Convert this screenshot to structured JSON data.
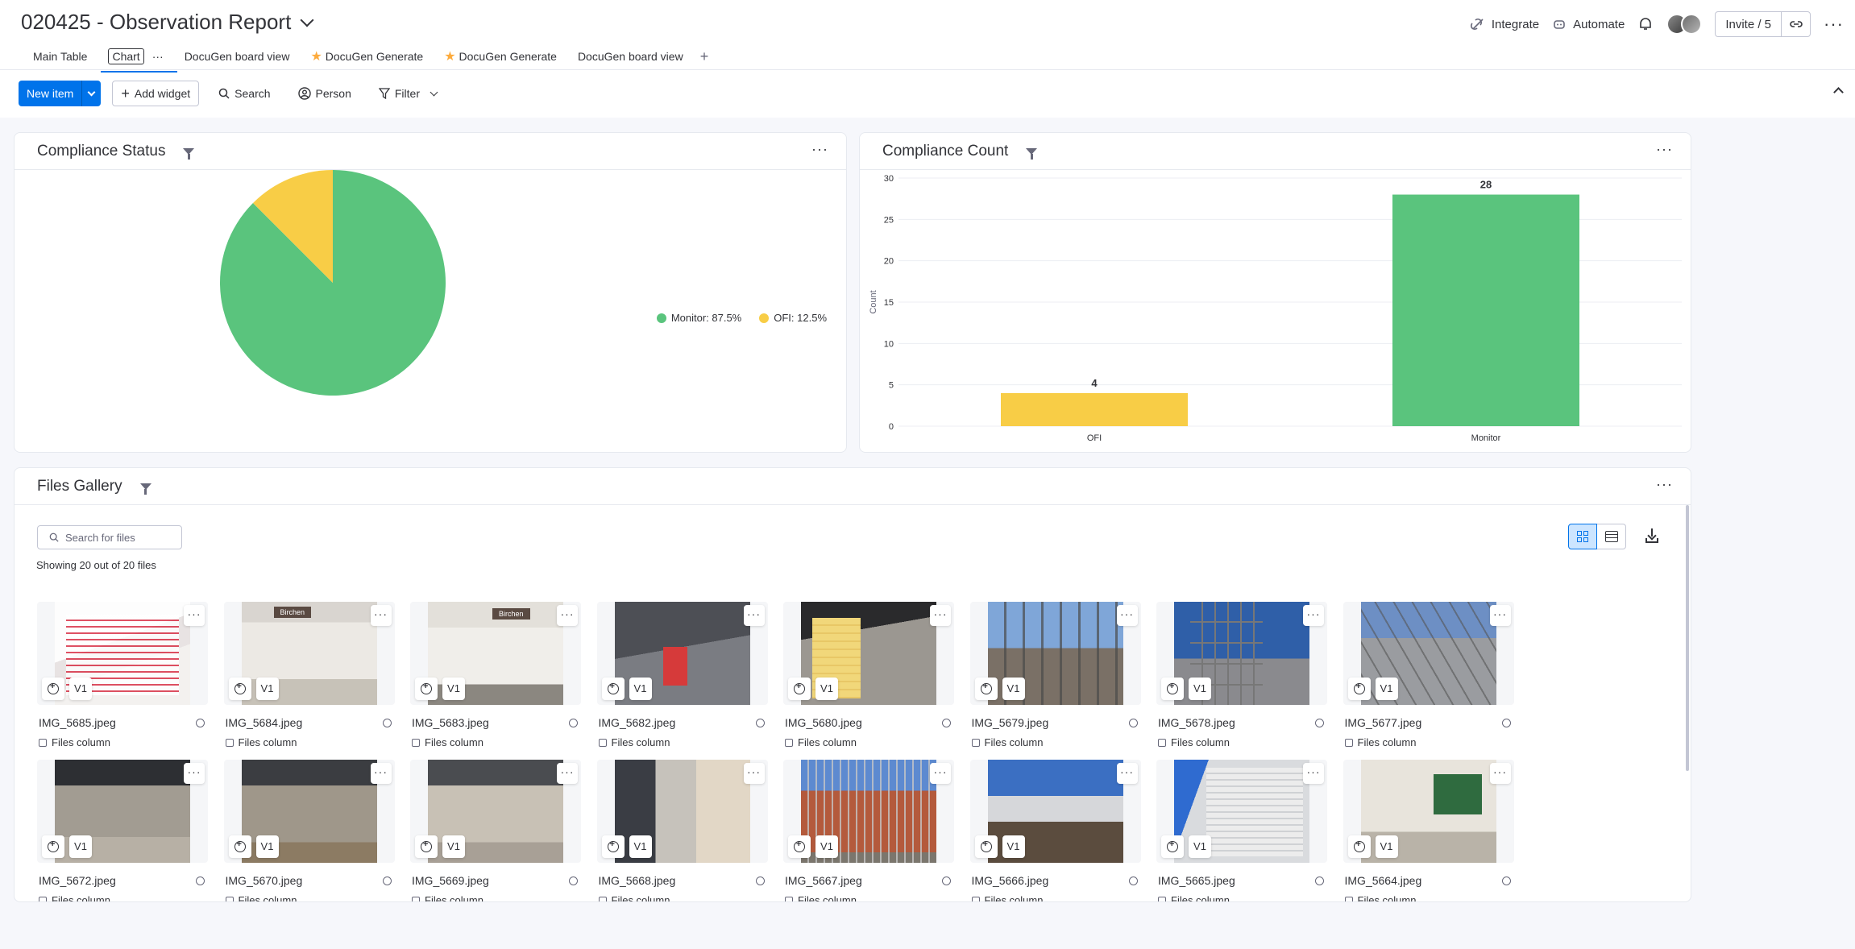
{
  "board": {
    "title": "020425 - Observation Report",
    "integrate_label": "Integrate",
    "automate_label": "Automate",
    "invite_label": "Invite / 5"
  },
  "tabs": [
    {
      "label": "Main Table"
    },
    {
      "label": "Chart"
    },
    {
      "label": "DocuGen board view"
    },
    {
      "label": "DocuGen Generate"
    },
    {
      "label": "DocuGen Generate"
    },
    {
      "label": "DocuGen board view"
    }
  ],
  "toolbar": {
    "new_item_label": "New item",
    "add_widget_label": "Add widget",
    "search_label": "Search",
    "person_label": "Person",
    "filter_label": "Filter"
  },
  "compliance_status": {
    "title": "Compliance Status",
    "legend": [
      {
        "label": "Monitor: 87.5%",
        "color": "#5ac47d"
      },
      {
        "label": "OFI: 12.5%",
        "color": "#f8cd46"
      }
    ]
  },
  "compliance_count": {
    "title": "Compliance Count"
  },
  "chart_data": [
    {
      "type": "pie",
      "title": "Compliance Status",
      "slices": [
        {
          "label": "Monitor",
          "value": 87.5,
          "color": "#5ac47d"
        },
        {
          "label": "OFI",
          "value": 12.5,
          "color": "#f8cd46"
        }
      ]
    },
    {
      "type": "bar",
      "title": "Compliance Count",
      "categories": [
        "OFI",
        "Monitor"
      ],
      "values": [
        4,
        28
      ],
      "colors": [
        "#f8cd46",
        "#5ac47d"
      ],
      "ylabel": "Count",
      "ylim": [
        0,
        30
      ],
      "yticks": [
        0,
        5,
        10,
        15,
        20,
        25,
        30
      ],
      "grid": true
    }
  ],
  "files_gallery": {
    "title": "Files Gallery",
    "search_placeholder": "Search for files",
    "showing_text": "Showing 20 out of 20 files",
    "version_label": "V1",
    "column_label": "Files column",
    "files": [
      {
        "name": "IMG_5685.jpeg",
        "img": "i1"
      },
      {
        "name": "IMG_5684.jpeg",
        "img": "i2"
      },
      {
        "name": "IMG_5683.jpeg",
        "img": "i3"
      },
      {
        "name": "IMG_5682.jpeg",
        "img": "i4"
      },
      {
        "name": "IMG_5680.jpeg",
        "img": "i5"
      },
      {
        "name": "IMG_5679.jpeg",
        "img": "i6"
      },
      {
        "name": "IMG_5678.jpeg",
        "img": "i7"
      },
      {
        "name": "IMG_5677.jpeg",
        "img": "i8"
      },
      {
        "name": "IMG_5672.jpeg",
        "img": "i9"
      },
      {
        "name": "IMG_5670.jpeg",
        "img": "i10"
      },
      {
        "name": "IMG_5669.jpeg",
        "img": "i11"
      },
      {
        "name": "IMG_5668.jpeg",
        "img": "i12"
      },
      {
        "name": "IMG_5667.jpeg",
        "img": "i13"
      },
      {
        "name": "IMG_5666.jpeg",
        "img": "i14"
      },
      {
        "name": "IMG_5665.jpeg",
        "img": "i15"
      },
      {
        "name": "IMG_5664.jpeg",
        "img": "i16"
      }
    ]
  }
}
